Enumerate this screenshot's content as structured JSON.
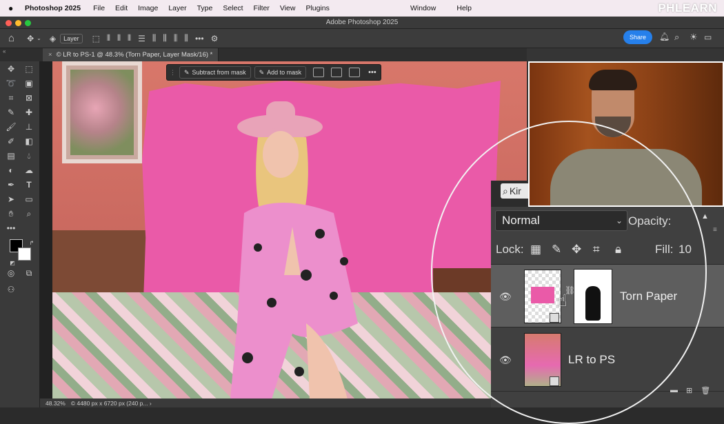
{
  "menubar": {
    "app": "Photoshop 2025",
    "items": [
      "File",
      "Edit",
      "Image",
      "Layer",
      "Type",
      "Select",
      "Filter",
      "View",
      "Plugins"
    ],
    "right_items": [
      "Window",
      "Help"
    ],
    "brand": "PHLEARN"
  },
  "window": {
    "title": "Adobe Photoshop 2025"
  },
  "options_bar": {
    "layer_select": "Layer",
    "share_label": "Share"
  },
  "document_tab": {
    "title": "© LR to PS-1 @ 48.3% (Torn Paper, Layer Mask/16) *"
  },
  "mask_toolbar": {
    "subtract": "Subtract from mask",
    "add": "Add to mask"
  },
  "status_bar": {
    "zoom": "48.32%",
    "info": "© 4480 px x 6720 px (240 p... ›"
  },
  "layers_panel": {
    "search_text": "Kir",
    "blend_mode": "Normal",
    "opacity_label": "Opacity:",
    "lock_label": "Lock:",
    "fill_label": "Fill:",
    "fill_value": "10",
    "layers": [
      {
        "name": "Torn Paper",
        "visible": true,
        "selected": true
      },
      {
        "name": "LR to PS",
        "visible": true,
        "selected": false
      }
    ]
  },
  "colors": {
    "accent": "#2680eb",
    "paper_pink": "#ea5aa8"
  }
}
